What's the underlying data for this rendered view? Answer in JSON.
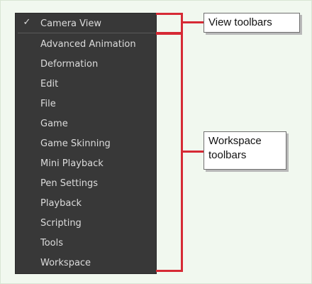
{
  "menu": {
    "checked_item": {
      "label": "Camera View",
      "check_icon": "check-icon"
    },
    "items": [
      {
        "label": "Advanced Animation"
      },
      {
        "label": "Deformation"
      },
      {
        "label": "Edit"
      },
      {
        "label": "File"
      },
      {
        "label": "Game"
      },
      {
        "label": "Game Skinning"
      },
      {
        "label": "Mini Playback"
      },
      {
        "label": "Pen Settings"
      },
      {
        "label": "Playback"
      },
      {
        "label": "Scripting"
      },
      {
        "label": "Tools"
      },
      {
        "label": "Workspace"
      }
    ]
  },
  "annotations": {
    "view_toolbars": "View toolbars",
    "workspace_toolbars_line1": "Workspace",
    "workspace_toolbars_line2": "toolbars"
  },
  "colors": {
    "annotation_red": "#d62a35",
    "menu_background": "#383838",
    "page_background": "#f1f8ef"
  }
}
